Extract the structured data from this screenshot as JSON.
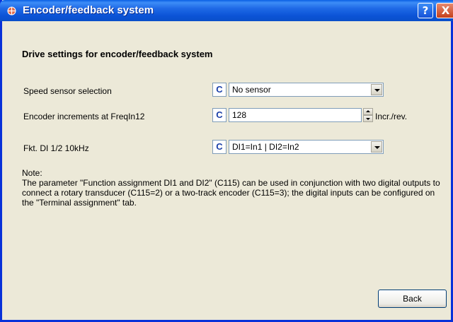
{
  "window": {
    "title": "Encoder/feedback system",
    "help_label": "?",
    "close_label": "X"
  },
  "heading": "Drive settings for encoder/feedback system",
  "rows": [
    {
      "label": "Speed sensor selection",
      "marker": "C",
      "value": "No sensor",
      "control": "dropdown"
    },
    {
      "label": "Encoder increments at FreqIn12",
      "marker": "C",
      "value": "128",
      "control": "spinner",
      "unit": "Incr./rev."
    },
    {
      "label": "Fkt. DI 1/2 10kHz",
      "marker": "C",
      "value": "DI1=In1 | DI2=In2",
      "control": "dropdown"
    }
  ],
  "note": {
    "title": "Note:",
    "body": "The parameter \"Function assignment DI1 and DI2\" (C115) can be used in conjunction with two digital outputs to connect a rotary transducer (C115=2) or a two-track encoder (C115=3); the digital inputs can be configured on the \"Terminal assignment\" tab."
  },
  "buttons": {
    "back": "Back"
  },
  "colors": {
    "title_bar": "#0a53d6",
    "window_bg": "#ece9d8",
    "marker_text": "#1a3fa8"
  }
}
